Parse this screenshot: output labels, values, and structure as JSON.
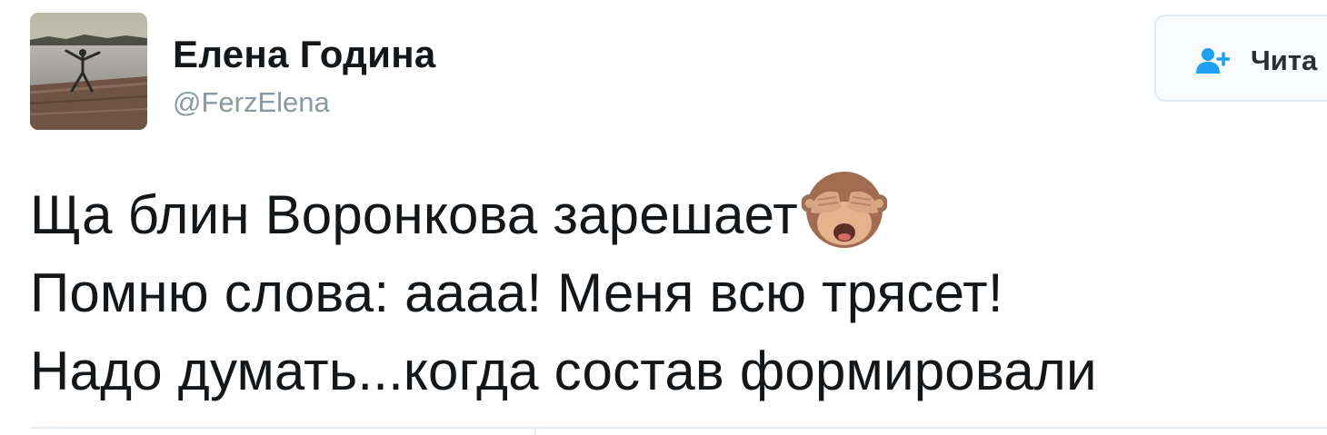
{
  "author": {
    "display_name": "Елена Година",
    "handle": "@FerzElena",
    "avatar_icon": "profile-photo"
  },
  "follow_button": {
    "label": "Чита",
    "icon": "follow-icon",
    "accent_color": "#1da1f2"
  },
  "tweet": {
    "lines": [
      "Ща блин Воронкова зарешает",
      "Помню слова: аааа! Меня всю трясет!",
      "Надо думать...когда состав формировали"
    ],
    "emoji_icon": "see-no-evil-monkey"
  },
  "colors": {
    "text": "#14171a",
    "secondary_text": "#8899a6",
    "border": "#e1e8ed"
  }
}
